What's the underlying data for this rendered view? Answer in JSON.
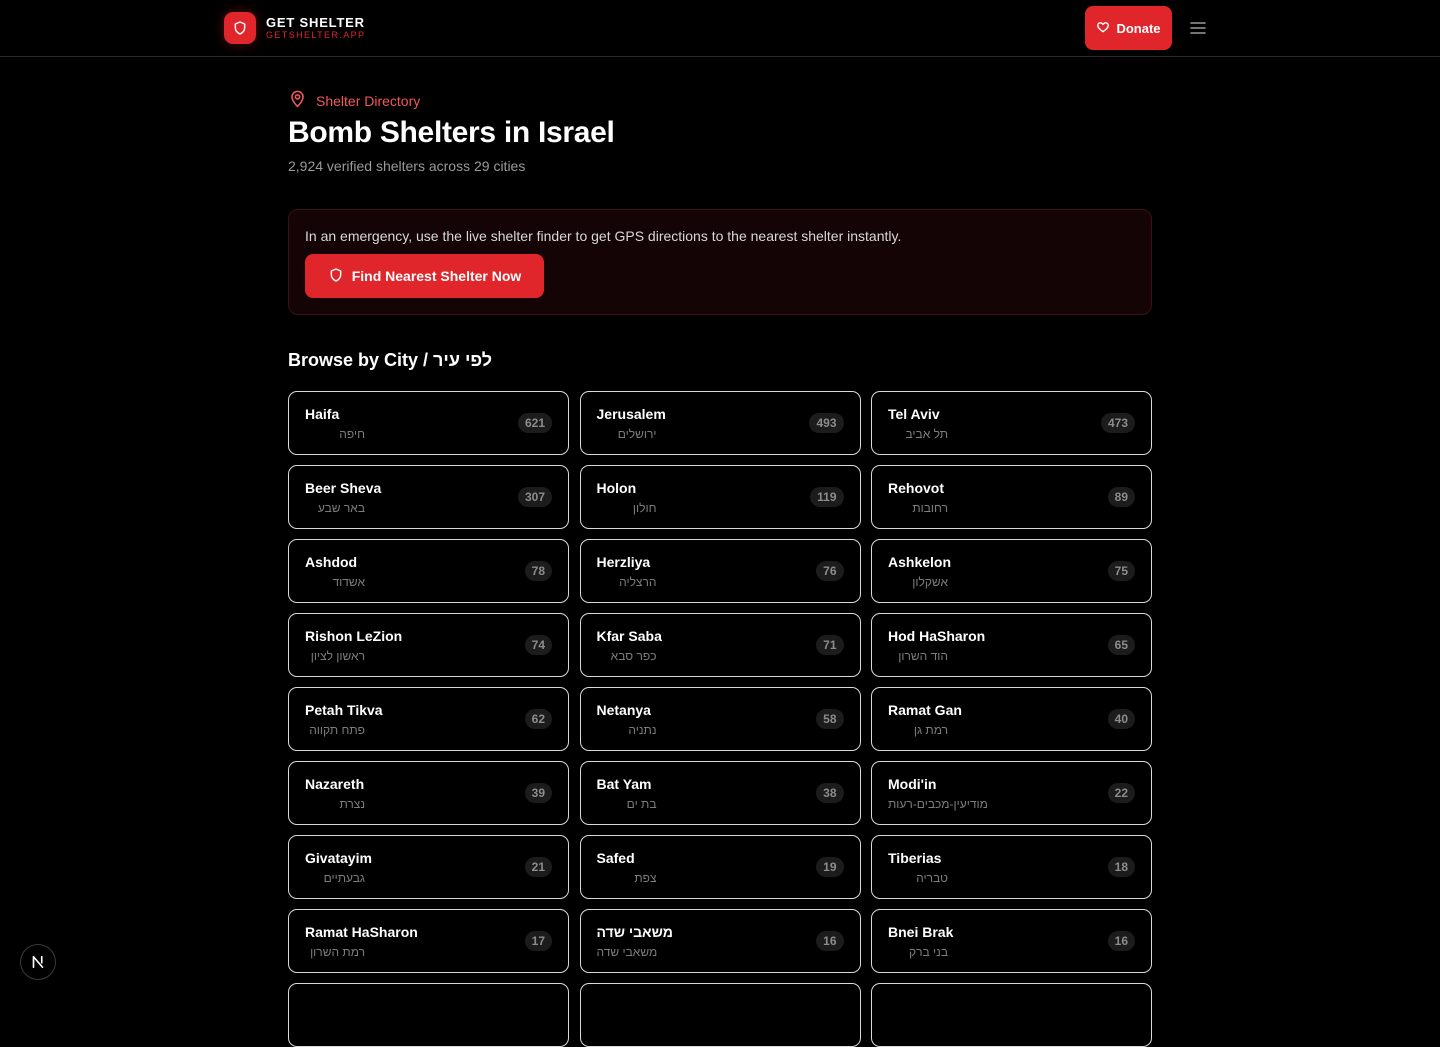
{
  "header": {
    "brand_name": "GET SHELTER",
    "brand_domain": "GETSHELTER.APP",
    "donate_label": "Donate",
    "brand_color": "#e0262b"
  },
  "hero": {
    "breadcrumb": "Shelter Directory",
    "title": "Bomb Shelters in Israel",
    "subtitle": "2,924 verified shelters across 29 cities"
  },
  "alert": {
    "text": "In an emergency, use the live shelter finder to get GPS directions to the nearest shelter instantly.",
    "button_label": "Find Nearest Shelter Now"
  },
  "browse": {
    "title": "Browse by City / לפי עיר",
    "cities": [
      {
        "name": "Haifa",
        "hebrew": "חיפה",
        "count": "621"
      },
      {
        "name": "Jerusalem",
        "hebrew": "ירושלים",
        "count": "493"
      },
      {
        "name": "Tel Aviv",
        "hebrew": "תל אביב",
        "count": "473"
      },
      {
        "name": "Beer Sheva",
        "hebrew": "באר שבע",
        "count": "307"
      },
      {
        "name": "Holon",
        "hebrew": "חולון",
        "count": "119"
      },
      {
        "name": "Rehovot",
        "hebrew": "רחובות",
        "count": "89"
      },
      {
        "name": "Ashdod",
        "hebrew": "אשדוד",
        "count": "78"
      },
      {
        "name": "Herzliya",
        "hebrew": "הרצליה",
        "count": "76"
      },
      {
        "name": "Ashkelon",
        "hebrew": "אשקלון",
        "count": "75"
      },
      {
        "name": "Rishon LeZion",
        "hebrew": "ראשון לציון",
        "count": "74"
      },
      {
        "name": "Kfar Saba",
        "hebrew": "כפר סבא",
        "count": "71"
      },
      {
        "name": "Hod HaSharon",
        "hebrew": "הוד השרון",
        "count": "65"
      },
      {
        "name": "Petah Tikva",
        "hebrew": "פתח תקווה",
        "count": "62"
      },
      {
        "name": "Netanya",
        "hebrew": "נתניה",
        "count": "58"
      },
      {
        "name": "Ramat Gan",
        "hebrew": "רמת גן",
        "count": "40"
      },
      {
        "name": "Nazareth",
        "hebrew": "נצרת",
        "count": "39"
      },
      {
        "name": "Bat Yam",
        "hebrew": "בת ים",
        "count": "38"
      },
      {
        "name": "Modi'in",
        "hebrew": "מודיעין-מכבים-רעות",
        "count": "22"
      },
      {
        "name": "Givatayim",
        "hebrew": "גבעתיים",
        "count": "21"
      },
      {
        "name": "Safed",
        "hebrew": "צפת",
        "count": "19"
      },
      {
        "name": "Tiberias",
        "hebrew": "טבריה",
        "count": "18"
      },
      {
        "name": "Ramat HaSharon",
        "hebrew": "רמת השרון",
        "count": "17"
      },
      {
        "name": "משאבי שדה",
        "hebrew": "משאבי שדה",
        "count": "16"
      },
      {
        "name": "Bnei Brak",
        "hebrew": "בני ברק",
        "count": "16"
      }
    ]
  },
  "icons": {
    "brand": "shield-icon",
    "donate": "heart-icon",
    "menu": "hamburger-menu-icon",
    "breadcrumb": "map-pin-icon",
    "find": "shield-icon",
    "dev_badge": "nextjs-icon"
  }
}
